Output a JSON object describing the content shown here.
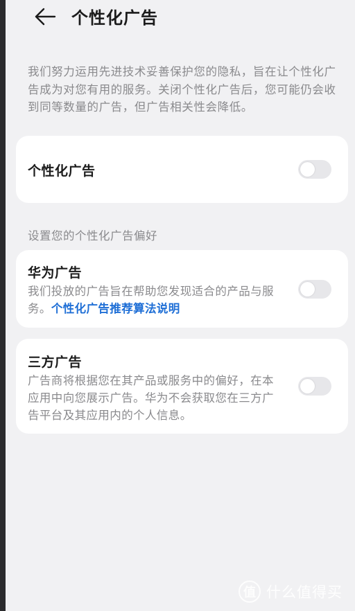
{
  "header": {
    "title": "个性化广告",
    "back_icon": "arrow-left-icon"
  },
  "intro": "我们努力运用先进技术妥善保护您的隐私，旨在让个性化广告成为对您有用的服务。关闭个性化广告后，您可能仍会收到同等数量的广告，但广告相关性会降低。",
  "main_toggle": {
    "label": "个性化广告",
    "enabled": false
  },
  "preferences": {
    "section_label": "设置您的个性化广告偏好",
    "huawei": {
      "title": "华为广告",
      "desc": "我们投放的广告旨在帮助您发现适合的产品与服务。",
      "link": "个性化广告推荐算法说明",
      "enabled": false
    },
    "third_party": {
      "title": "三方广告",
      "desc": "广告商将根据您在其产品或服务中的偏好，在本应用中向您展示广告。华为不会获取您在三方广告平台及其应用内的个人信息。",
      "enabled": false
    }
  },
  "watermark": {
    "logo_char": "值",
    "text": "什么值得买"
  },
  "colors": {
    "background": "#f1f1f3",
    "card": "#ffffff",
    "link": "#1f6fd6",
    "secondary_text": "#8a8a8d",
    "toggle_off": "#e7e7ea"
  }
}
